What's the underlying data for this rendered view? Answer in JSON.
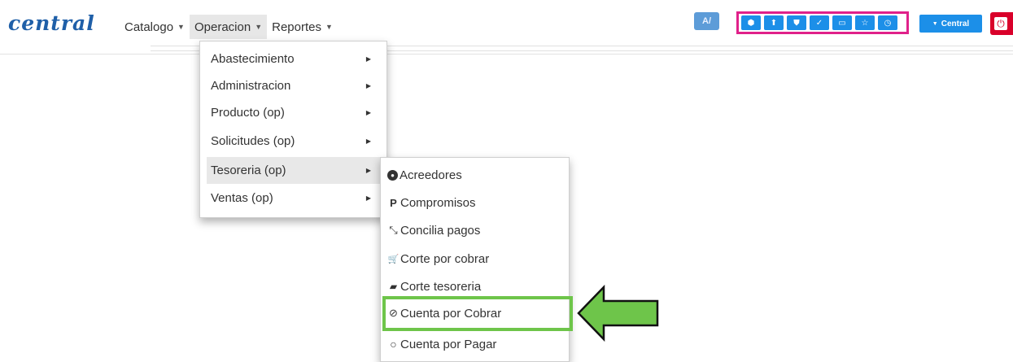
{
  "brand": "central",
  "nav": {
    "items": [
      {
        "label": "Catalogo"
      },
      {
        "label": "Operacion"
      },
      {
        "label": "Reportes"
      }
    ]
  },
  "toolbar": {
    "buttons": [
      "cube-icon",
      "upload-icon",
      "shield-icon",
      "check-circle-icon",
      "ticket-icon",
      "star-icon",
      "clock-icon"
    ],
    "central_label": "Central"
  },
  "operacion_menu": {
    "items": [
      {
        "label": "Abastecimiento"
      },
      {
        "label": "Administracion"
      },
      {
        "label": "Producto (op)"
      },
      {
        "label": "Solicitudes (op)"
      },
      {
        "label": "Tesoreria (op)"
      },
      {
        "label": "Ventas (op)"
      }
    ]
  },
  "tesoreria_menu": {
    "items": [
      {
        "label": "Acreedores",
        "icon": "user-circle-icon"
      },
      {
        "label": "Compromisos",
        "icon": "paypal-icon"
      },
      {
        "label": "Concilia pagos",
        "icon": "compress-icon"
      },
      {
        "label": "Corte por cobrar",
        "icon": "cart-icon"
      },
      {
        "label": "Corte tesoreria",
        "icon": "book-icon"
      },
      {
        "label": "Cuenta por Cobrar",
        "icon": "check-circle-icon"
      },
      {
        "label": "Cuenta por Pagar",
        "icon": "circle-icon"
      }
    ]
  },
  "colors": {
    "accent": "#1c8fe8",
    "highlight": "#6ec54a",
    "toolbar_border": "#e0218a",
    "danger": "#d9002a"
  }
}
